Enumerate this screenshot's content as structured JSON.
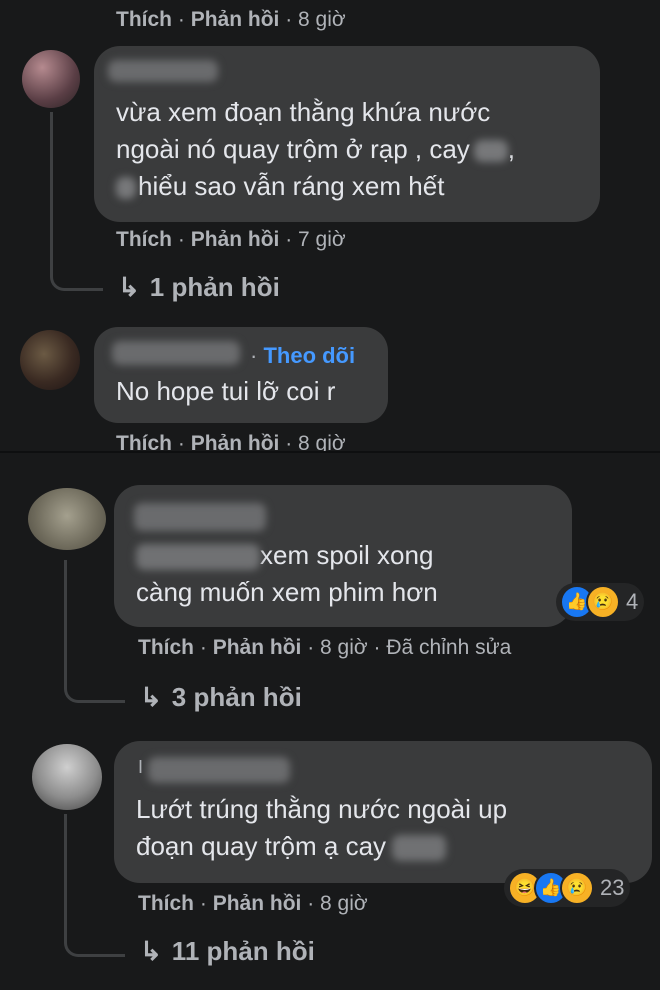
{
  "top_actions": {
    "like": "Thích",
    "reply": "Phản hồi",
    "time": "8 giờ"
  },
  "comments": [
    {
      "text_lines": [
        "vừa xem đoạn thằng khứa nước",
        "ngoài nó quay trộm ở rạp , cay",
        "hiểu sao vẫn ráng xem hết"
      ],
      "actions": {
        "like": "Thích",
        "reply": "Phản hồi",
        "time": "7 giờ"
      },
      "replies_label": "1 phản hồi"
    },
    {
      "follow_label": "Theo dõi",
      "text_lines": [
        "No hope tui lỡ coi r"
      ],
      "actions": {
        "like": "Thích",
        "reply": "Phản hồi",
        "time": "8 giờ"
      }
    },
    {
      "text_lines": [
        "xem spoil xong",
        "càng muốn xem phim hơn"
      ],
      "actions": {
        "like": "Thích",
        "reply": "Phản hồi",
        "time": "8 giờ",
        "edited": "Đã chỉnh sửa"
      },
      "reaction_count": "4",
      "replies_label": "3 phản hồi"
    },
    {
      "text_lines": [
        "Lướt trúng thằng nước ngoài up",
        "đoạn quay trộm ạ cay"
      ],
      "actions": {
        "like": "Thích",
        "reply": "Phản hồi",
        "time": "8 giờ"
      },
      "reaction_count": "23",
      "replies_label": "11 phản hồi"
    }
  ],
  "glyphs": {
    "dot": "·",
    "reply_arrow": "↳",
    "like_icon": "👍",
    "sad_icon": "😢",
    "haha_icon": "😆"
  },
  "colors": {
    "background": "#18191a",
    "bubble": "#3a3b3c",
    "text": "#e4e6eb",
    "muted": "#b0b3b8",
    "link": "#4599ff"
  }
}
